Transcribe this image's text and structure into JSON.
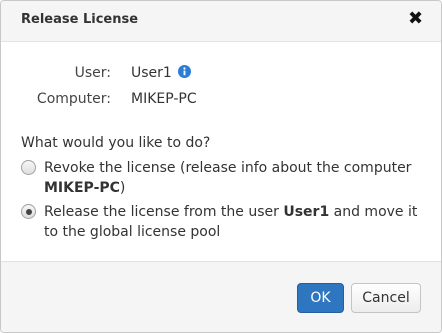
{
  "dialog": {
    "title": "Release License",
    "close_icon": "close-icon"
  },
  "info": {
    "user_label": "User:",
    "user_value": "User1",
    "user_info_icon": "info-icon",
    "computer_label": "Computer:",
    "computer_value": "MIKEP-PC"
  },
  "question": "What would you like to do?",
  "options": [
    {
      "text_before": "Revoke the license (release info about the computer ",
      "bold": "MIKEP-PC",
      "text_after": ")",
      "selected": false
    },
    {
      "text_before": "Release the license from the user ",
      "bold": "User1",
      "text_after": " and move it to the global license pool",
      "selected": true
    }
  ],
  "buttons": {
    "ok": "OK",
    "cancel": "Cancel"
  },
  "colors": {
    "primary": "#2f76c1",
    "info_icon": "#2a7dd4"
  }
}
